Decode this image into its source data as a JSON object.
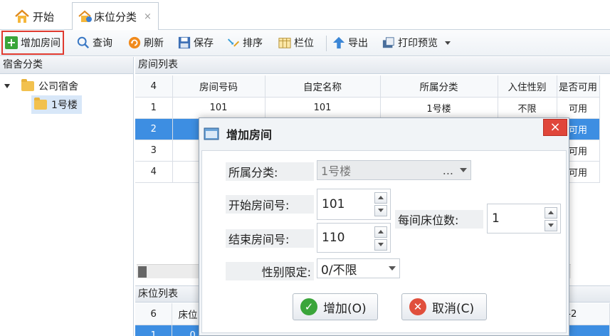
{
  "tabs": [
    {
      "label": "开始"
    },
    {
      "label": "床位分类",
      "close": "×"
    }
  ],
  "toolbar": {
    "add_room": "增加房间",
    "query": "查询",
    "refresh": "刷新",
    "save": "保存",
    "sort": "排序",
    "columns": "栏位",
    "export": "导出",
    "print_preview": "打印预览"
  },
  "left_panel": {
    "title": "宿舍分类",
    "tree": [
      {
        "label": "公司宿舍"
      },
      {
        "label": "1号楼"
      }
    ]
  },
  "room_list": {
    "title": "房间列表",
    "count": "4",
    "columns": [
      "房间号码",
      "自定名称",
      "所属分类",
      "入住性别",
      "是否可用"
    ],
    "rows": [
      {
        "n": "1",
        "no": "101",
        "name": "101",
        "cat": "1号楼",
        "sex": "不限",
        "avail": "可用"
      },
      {
        "n": "2",
        "avail": "可用"
      },
      {
        "n": "3",
        "avail": "可用"
      },
      {
        "n": "4",
        "avail": "可用"
      }
    ]
  },
  "bed_list": {
    "title": "床位列表",
    "count": "6",
    "col1": "床位",
    "col_tail": "-2",
    "row1_n": "1",
    "row1_v": "0"
  },
  "dialog": {
    "title": "增加房间",
    "close": "×",
    "category_label": "所属分类:",
    "category_value": "1号楼",
    "category_ellipsis": "...",
    "start_label": "开始房间号:",
    "start_value": "101",
    "end_label": "结束房间号:",
    "end_value": "110",
    "beds_label": "每间床位数:",
    "beds_value": "1",
    "gender_label": "性别限定:",
    "gender_value": "0/不限",
    "add_button": "增加(O)",
    "cancel_button": "取消(C)"
  },
  "colors": {
    "selected_row": "#3d8ee2",
    "close_button": "#e0463a",
    "highlight_border": "#e03a2f"
  }
}
